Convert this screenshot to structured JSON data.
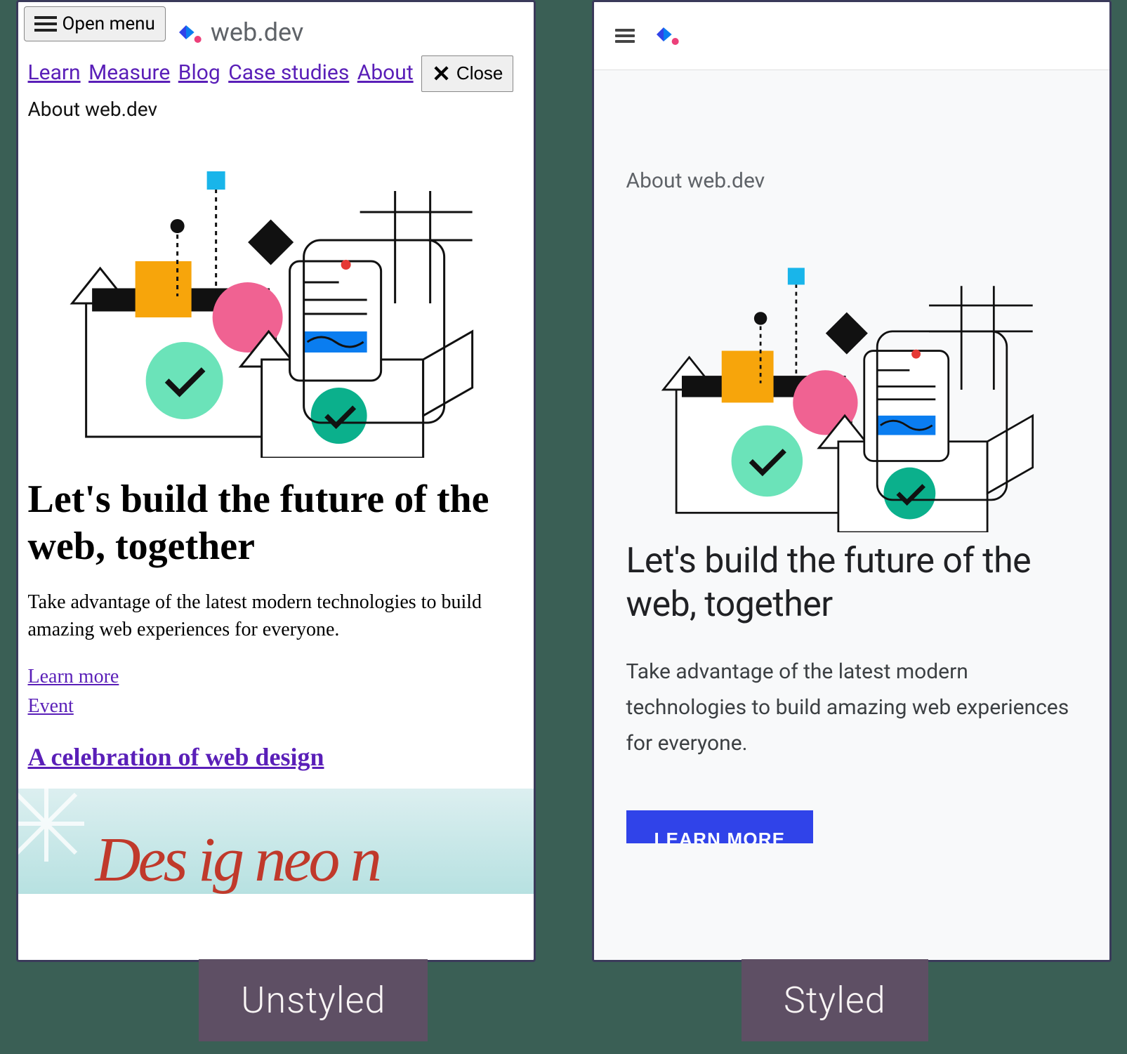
{
  "captions": {
    "left": "Unstyled",
    "right": "Styled"
  },
  "logo_text": "web.dev",
  "unstyled": {
    "open_menu": "Open menu",
    "nav": {
      "learn": "Learn",
      "measure": "Measure",
      "blog": "Blog",
      "case_studies": "Case studies",
      "about": "About"
    },
    "close": "Close",
    "eyebrow": "About web.dev",
    "heading": "Let's build the future of the web, together",
    "body": "Take advantage of the latest modern technologies to build amazing web experiences for everyone.",
    "learn_more": "Learn more",
    "event": "Event",
    "article_link": "A celebration of web design"
  },
  "styled": {
    "eyebrow": "About web.dev",
    "heading": "Let's build the future of the web, together",
    "body": "Take advantage of the latest modern technologies to build amazing web experiences for everyone.",
    "cta": "LEARN MORE"
  }
}
